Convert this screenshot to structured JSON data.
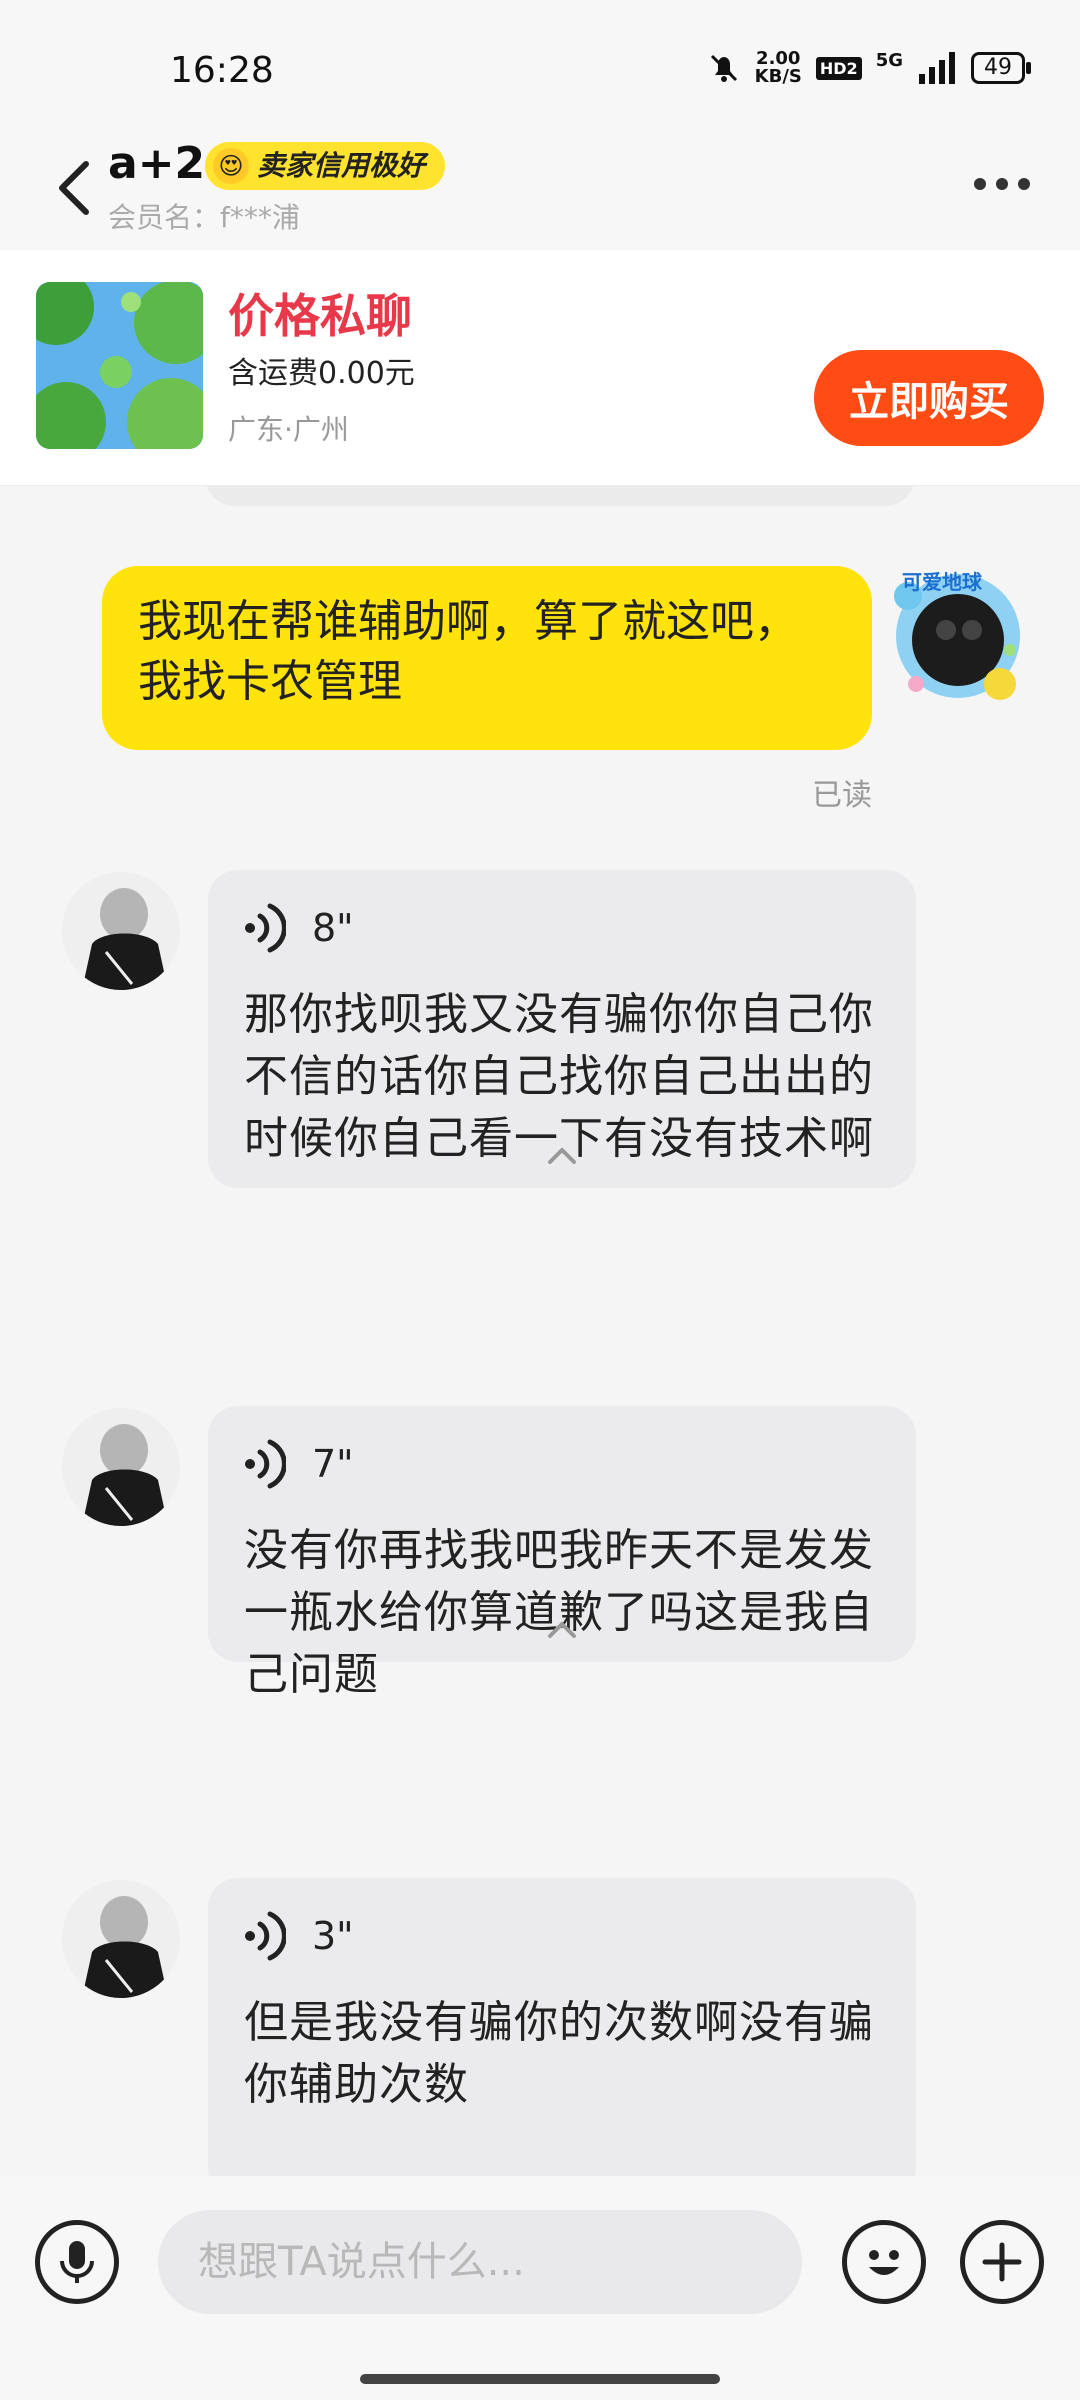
{
  "status_bar": {
    "time": "16:28",
    "speed_value": "2.00",
    "speed_unit": "KB/S",
    "hd_label": "HD2",
    "network": "5G",
    "battery": "49"
  },
  "header": {
    "name": "a+2",
    "badge": "卖家信用极好",
    "member_label": "会员名：",
    "member_id": "f***浦"
  },
  "product": {
    "price": "价格私聊",
    "shipping": "含运费0.00元",
    "location": "广东·广州",
    "buy_label": "立即购买"
  },
  "messages": {
    "my_text": "我现在帮谁辅助啊，算了就这吧，我找卡农管理",
    "my_avatar_label": "可爱地球",
    "read_status": "已读",
    "voice": [
      {
        "duration": "8\"",
        "text": "那你找呗我又没有骗你你自己你不信的话你自己找你自己出出的时候你自己看一下有没有技术啊"
      },
      {
        "duration": "7\"",
        "text": "没有你再找我吧我昨天不是发发一瓶水给你算道歉了吗这是我自己问题"
      },
      {
        "duration": "3\"",
        "text": "但是我没有骗你的次数啊没有骗你辅助次数"
      }
    ]
  },
  "input": {
    "placeholder": "想跟TA说点什么..."
  },
  "colors": {
    "accent_yellow": "#ffe30b",
    "buy_orange": "#ff4b14",
    "price_red": "#e8394a"
  }
}
